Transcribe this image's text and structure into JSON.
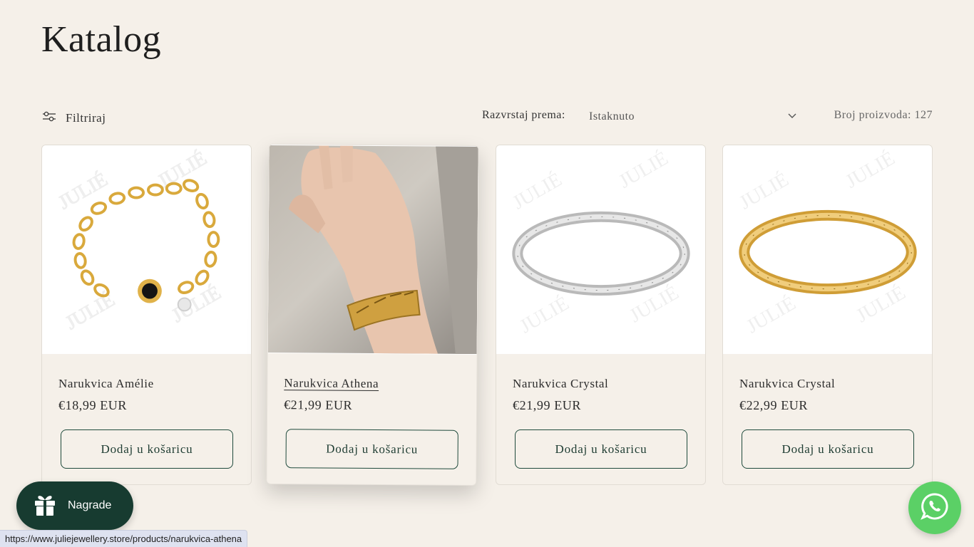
{
  "page": {
    "title": "Katalog"
  },
  "toolbar": {
    "filter_label": "Filtriraj",
    "sort_label": "Razvrstaj prema:",
    "sort_value": "Istaknuto",
    "count_label": "Broj proizvoda: 127"
  },
  "products": [
    {
      "title": "Narukvica Amélie",
      "price": "€18,99 EUR",
      "button": "Dodaj u košaricu",
      "image": "gold-chain-bracelet"
    },
    {
      "title": "Narukvica Athena",
      "price": "€21,99 EUR",
      "button": "Dodaj u košaricu",
      "image": "hand-wearing-gold-cuff"
    },
    {
      "title": "Narukvica Crystal",
      "price": "€21,99 EUR",
      "button": "Dodaj u košaricu",
      "image": "silver-bangle"
    },
    {
      "title": "Narukvica Crystal",
      "price": "€22,99 EUR",
      "button": "Dodaj u košaricu",
      "image": "gold-bangle"
    }
  ],
  "rewards": {
    "label": "Nagrade"
  },
  "status_url": "https://www.juliejewellery.store/products/narukvica-athena",
  "colors": {
    "background": "#f5f0e9",
    "accent": "#173b30",
    "whatsapp": "#5bd066"
  }
}
